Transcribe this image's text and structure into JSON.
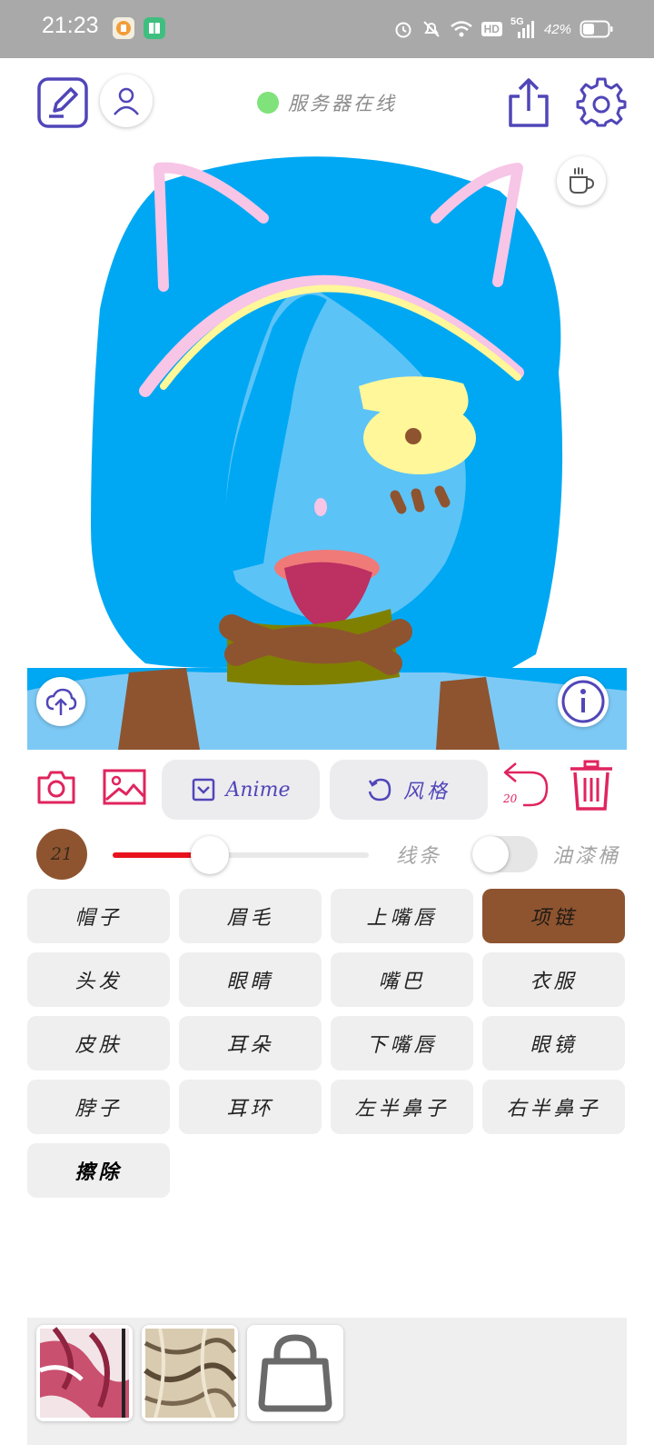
{
  "status_bar": {
    "time": "21:23",
    "battery_percent": "42%",
    "network": "5G",
    "hd_label": "HD",
    "app_icons": [
      "qq-browser-icon",
      "green-book-app-icon"
    ],
    "indicators": [
      "alarm-icon",
      "mute-icon",
      "wifi-icon",
      "hd-icon",
      "signal-icon",
      "battery-icon"
    ]
  },
  "header": {
    "server_status": "服务器在线",
    "server_status_color": "#7fe27a",
    "icons": [
      "edit-icon",
      "user-icon",
      "share-icon",
      "settings-icon",
      "coffee-icon"
    ]
  },
  "canvas": {
    "bottom_left_icon": "upload-cloud-icon",
    "bottom_right_icon": "info-icon"
  },
  "toolbar": {
    "camera_icon": "camera-icon",
    "gallery_icon": "image-icon",
    "model_label": "Anime",
    "style_label": "风格",
    "undo_count": "20",
    "delete_icon": "trash-icon"
  },
  "brush": {
    "size": "21",
    "color": "#8e5430",
    "size_level": 0.38,
    "mode_line": "线条",
    "mode_fill": "油漆桶",
    "fill_mode_on": false
  },
  "parts": [
    {
      "label": "帽子",
      "selected": false
    },
    {
      "label": "眉毛",
      "selected": false
    },
    {
      "label": "上嘴唇",
      "selected": false
    },
    {
      "label": "项链",
      "selected": true
    },
    {
      "label": "头发",
      "selected": false
    },
    {
      "label": "眼睛",
      "selected": false
    },
    {
      "label": "嘴巴",
      "selected": false
    },
    {
      "label": "衣服",
      "selected": false
    },
    {
      "label": "皮肤",
      "selected": false
    },
    {
      "label": "耳朵",
      "selected": false
    },
    {
      "label": "下嘴唇",
      "selected": false
    },
    {
      "label": "眼镜",
      "selected": false
    },
    {
      "label": "脖子",
      "selected": false
    },
    {
      "label": "耳环",
      "selected": false
    },
    {
      "label": "左半鼻子",
      "selected": false
    },
    {
      "label": "右半鼻子",
      "selected": false
    },
    {
      "label": "擦除",
      "selected": false
    }
  ],
  "tray": {
    "items": [
      "pink-texture-thumbnail",
      "beige-texture-thumbnail",
      "locked-item"
    ]
  },
  "colors": {
    "accent": "#5046b8",
    "danger": "#e0245e",
    "selected_part": "#8e5430"
  }
}
